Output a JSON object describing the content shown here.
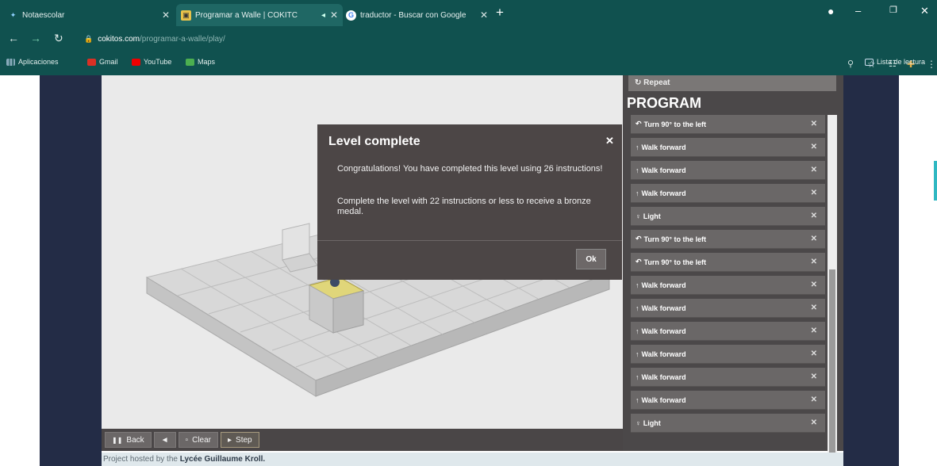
{
  "browser": {
    "tabs": [
      {
        "label": "Notaescolar"
      },
      {
        "label": "Programar a Walle | COKITC"
      },
      {
        "label": "traductor - Buscar con Google"
      }
    ],
    "address": {
      "host": "cokitos.com",
      "path": "/programar-a-walle/play/"
    },
    "bookmarks": [
      "Aplicaciones",
      "Gmail",
      "YouTube",
      "Maps"
    ],
    "reading_list": "Lista de lectura"
  },
  "game": {
    "controls": {
      "back": "Back",
      "prev": "◄",
      "clear": "Clear",
      "step": "Step"
    }
  },
  "program": {
    "repeat_label": "Repeat",
    "title": "PROGRAM",
    "items": [
      {
        "label": "Turn 90° to the left"
      },
      {
        "label": "Walk forward"
      },
      {
        "label": "Walk forward"
      },
      {
        "label": "Walk forward"
      },
      {
        "label": "Light"
      },
      {
        "label": "Turn 90° to the left"
      },
      {
        "label": "Turn 90° to the left"
      },
      {
        "label": "Walk forward"
      },
      {
        "label": "Walk forward"
      },
      {
        "label": "Walk forward"
      },
      {
        "label": "Walk forward"
      },
      {
        "label": "Walk forward"
      },
      {
        "label": "Walk forward"
      },
      {
        "label": "Light"
      }
    ]
  },
  "modal": {
    "title": "Level complete",
    "message1": "Congratulations! You have completed this level using 26 instructions!",
    "message2": "Complete the level with 22 instructions or less to receive a bronze medal.",
    "ok": "Ok"
  },
  "footer": {
    "prefix": "Project hosted by the",
    "school": "Lycée Guillaume Kroll."
  }
}
